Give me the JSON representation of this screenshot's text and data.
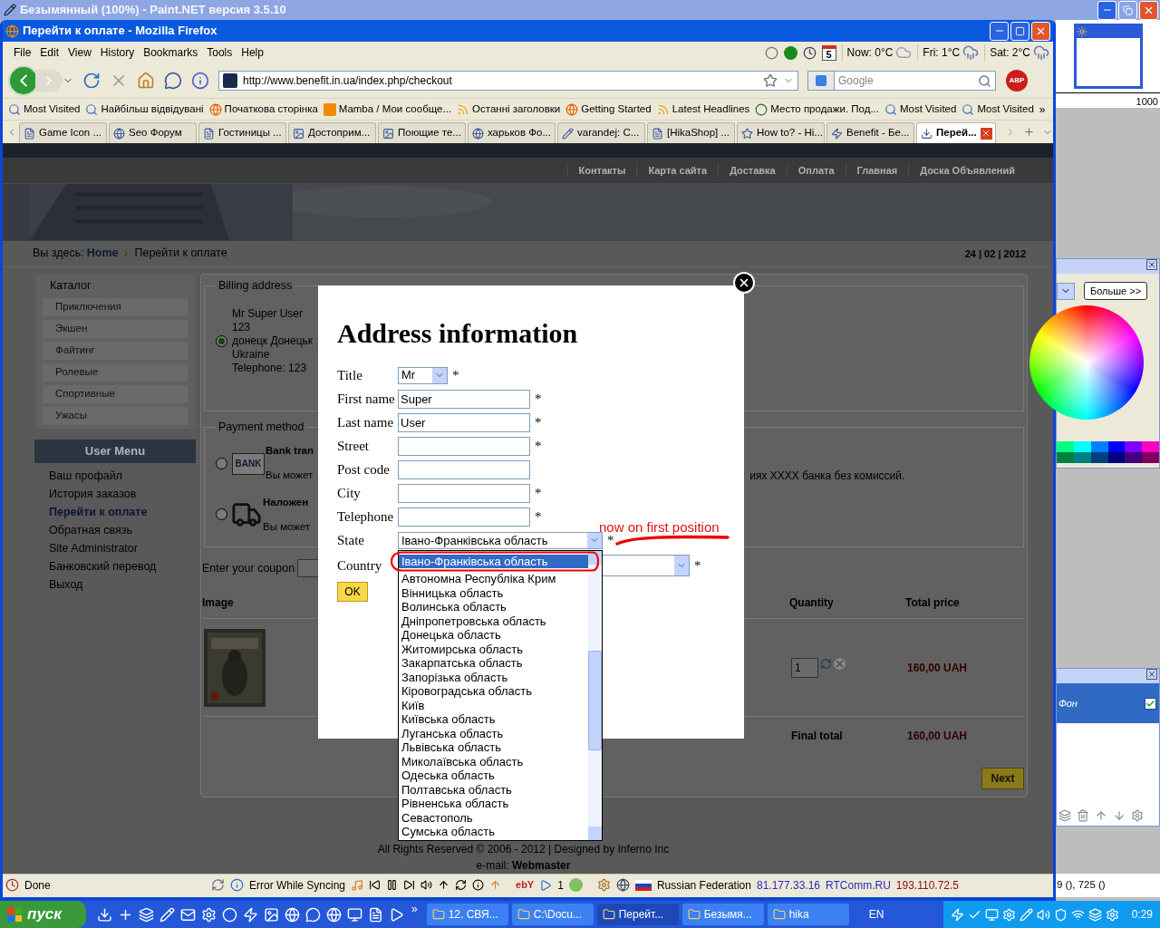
{
  "paint_title": "Безымянный (100%) - Paint.NET версия 3.5.10",
  "browser": {
    "title": "Перейти к оплате - Mozilla Firefox",
    "menu": [
      "File",
      "Edit",
      "View",
      "History",
      "Bookmarks",
      "Tools",
      "Help"
    ],
    "calendar_day": "5",
    "weather": [
      "Now: 0°C",
      "Fri: 1°C",
      "Sat: 2°C"
    ],
    "address": "http://www.benefit.in.ua/index.php/checkout",
    "search": {
      "placeholder": "Google"
    },
    "adblock": "ABP",
    "bookmarks": [
      {
        "label": "Most Visited",
        "kind": "folder"
      },
      {
        "label": "Найбільш відвідувані",
        "kind": "folder"
      },
      {
        "label": "Початкова сторінка",
        "kind": "globe"
      },
      {
        "label": "Mamba / Мои сообще...",
        "kind": "mamba"
      },
      {
        "label": "Останні заголовки",
        "kind": "feed"
      },
      {
        "label": "Getting Started",
        "kind": "globe"
      },
      {
        "label": "Latest Headlines",
        "kind": "feed"
      },
      {
        "label": "Место продажи. Под...",
        "kind": "site"
      },
      {
        "label": "Most Visited",
        "kind": "folder"
      },
      {
        "label": "Most Visited",
        "kind": "folder"
      }
    ],
    "bookmarks_more": "»",
    "tabs": [
      {
        "label": "Game Icon ...",
        "selected": false
      },
      {
        "label": "Seo Форум",
        "selected": false
      },
      {
        "label": "Гостиницы ...",
        "selected": false
      },
      {
        "label": "Достоприм...",
        "selected": false
      },
      {
        "label": "Поющие те...",
        "selected": false
      },
      {
        "label": "харьков Фо...",
        "selected": false
      },
      {
        "label": "varandej: C...",
        "selected": false
      },
      {
        "label": "[HikaShop] ...",
        "selected": false
      },
      {
        "label": "How to? - Hi...",
        "selected": false
      },
      {
        "label": "Benefit - Бе...",
        "selected": false
      },
      {
        "label": "Перей...",
        "selected": true
      }
    ]
  },
  "site": {
    "nav": [
      "Контакты",
      "Карта сайта",
      "Доставка",
      "Оплата",
      "Главная",
      "Доска Объявлений"
    ],
    "breadcrumb": {
      "prefix": "Вы здесь:",
      "home": "Home",
      "current": "Перейти к оплате"
    },
    "date": "24 | 02 | 2012",
    "catalog": {
      "title": "Каталог",
      "items": [
        "Приключения",
        "Экшен",
        "Файтинг",
        "Ролевые",
        "Спортивные",
        "Ужасы"
      ]
    },
    "user_menu": {
      "title": "User Menu",
      "items": [
        {
          "label": "Ваш профайл",
          "selected": false
        },
        {
          "label": "История заказов",
          "selected": false
        },
        {
          "label": "Перейти к оплате",
          "selected": true
        },
        {
          "label": "Обратная связь",
          "selected": false
        },
        {
          "label": "Site Administrator",
          "selected": false
        },
        {
          "label": "Банковский перевод",
          "selected": false
        },
        {
          "label": "Выход",
          "selected": false
        }
      ]
    },
    "billing": {
      "legend": "Billing address",
      "selected": true,
      "lines": [
        "Mr Super User",
        "123",
        "донецк Донецьк",
        "Ukraine",
        "Telephone: 123"
      ]
    },
    "payment": {
      "legend": "Payment method",
      "methods": [
        {
          "kind": "bank",
          "name": "Bank tran",
          "icon_text": "BANK",
          "description": "Вы может",
          "note": "иях XXXX банка без комиссий.",
          "selected": false
        },
        {
          "kind": "delivery",
          "name": "Наложен",
          "description": "Вы может",
          "selected": false
        }
      ]
    },
    "coupon_label": "Enter your coupon",
    "cart": {
      "columns": [
        "Image",
        "Quantity",
        "Total price"
      ],
      "rows": [
        {
          "quantity": "1",
          "total": "160,00 UAH"
        }
      ],
      "final_label": "Final total",
      "final_total": "160,00 UAH",
      "next": "Next"
    },
    "footer": {
      "rights": "All Rights Reserved © 2006 - 2012 | Designed by Inferno Inc",
      "email": "e-mail: **Webmaster**"
    }
  },
  "modal": {
    "title": "Address information",
    "fields": [
      {
        "label": "Title",
        "kind": "select",
        "value": "Mr",
        "mark": "*"
      },
      {
        "label": "First name",
        "kind": "text",
        "value": "Super",
        "mark": "*"
      },
      {
        "label": "Last name",
        "kind": "text",
        "value": "User",
        "mark": "*"
      },
      {
        "label": "Street",
        "kind": "text",
        "mark": "*"
      },
      {
        "label": "Post code",
        "kind": "text"
      },
      {
        "label": "City",
        "kind": "text",
        "mark": "*"
      },
      {
        "label": "Telephone",
        "kind": "text",
        "mark": "*"
      },
      {
        "label": "State",
        "kind": "open-select",
        "value": "Івано-Франківська область",
        "mark": "*",
        "options": [
          {
            "label": "Івано-Франківська область",
            "selected": true
          },
          {
            "label": "Автономна Республіка Крим",
            "selected": false
          },
          {
            "label": "Вінницька область",
            "selected": false
          },
          {
            "label": "Волинська область",
            "selected": false
          },
          {
            "label": "Дніпропетровська область",
            "selected": false
          },
          {
            "label": "Донецька область",
            "selected": false
          },
          {
            "label": "Житомирська область",
            "selected": false
          },
          {
            "label": "Закарпатська область",
            "selected": false
          },
          {
            "label": "Запорізька область",
            "selected": false
          },
          {
            "label": "Кіровоградська область",
            "selected": false
          },
          {
            "label": "Київ",
            "selected": false
          },
          {
            "label": "Київська область",
            "selected": false
          },
          {
            "label": "Луганська область",
            "selected": false
          },
          {
            "label": "Львівська область",
            "selected": false
          },
          {
            "label": "Миколаївська область",
            "selected": false
          },
          {
            "label": "Одеська область",
            "selected": false
          },
          {
            "label": "Полтавська область",
            "selected": false
          },
          {
            "label": "Рівненська область",
            "selected": false
          },
          {
            "label": "Севастополь",
            "selected": false
          },
          {
            "label": "Сумська область",
            "selected": false
          }
        ]
      },
      {
        "label": "Country",
        "kind": "wide-select",
        "mark": "*"
      }
    ],
    "ok": "OK"
  },
  "annotation": "now on first position",
  "status": {
    "left": "Done",
    "sync": "Error While Syncing",
    "ebay": "ebY",
    "count": "1",
    "country": "Russian Federation",
    "ip": "81.177.33.16",
    "isp": "RTComm.RU",
    "ip2": "193.110.72.5"
  },
  "paint": {
    "ruler": "1000",
    "more": "Больше >>",
    "layers": [
      {
        "name": "Фон",
        "visible": true,
        "selected": true
      }
    ],
    "coords": "9 (), 725 ()"
  },
  "taskbar": {
    "start": "пуск",
    "more": "»",
    "tasks": [
      {
        "label": "12. СВЯ...",
        "selected": false
      },
      {
        "label": "C:\\Docu...",
        "selected": false
      },
      {
        "label": "Перейт...",
        "selected": true
      },
      {
        "label": "Безымя...",
        "selected": false
      },
      {
        "label": "hika",
        "selected": false
      }
    ],
    "lang": "EN",
    "clock": "0:29"
  }
}
